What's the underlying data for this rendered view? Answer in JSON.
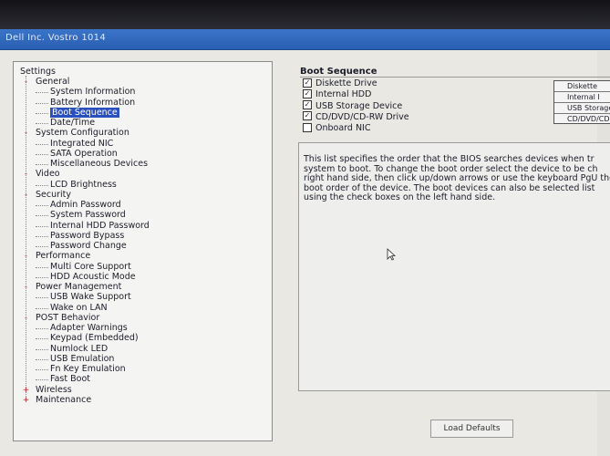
{
  "window": {
    "title": "Dell Inc. Vostro 1014"
  },
  "tree": {
    "root_label": "Settings",
    "items": [
      {
        "label": "General",
        "level": 1,
        "expander": "-"
      },
      {
        "label": "System Information",
        "level": 2
      },
      {
        "label": "Battery Information",
        "level": 2
      },
      {
        "label": "Boot Sequence",
        "level": 2,
        "selected": true
      },
      {
        "label": "Date/Time",
        "level": 2
      },
      {
        "label": "System Configuration",
        "level": 1,
        "expander": "-"
      },
      {
        "label": "Integrated NIC",
        "level": 2
      },
      {
        "label": "SATA Operation",
        "level": 2
      },
      {
        "label": "Miscellaneous Devices",
        "level": 2
      },
      {
        "label": "Video",
        "level": 1,
        "expander": "-"
      },
      {
        "label": "LCD Brightness",
        "level": 2
      },
      {
        "label": "Security",
        "level": 1,
        "expander": "-"
      },
      {
        "label": "Admin Password",
        "level": 2
      },
      {
        "label": "System Password",
        "level": 2
      },
      {
        "label": "Internal HDD Password",
        "level": 2
      },
      {
        "label": "Password Bypass",
        "level": 2
      },
      {
        "label": "Password Change",
        "level": 2
      },
      {
        "label": "Performance",
        "level": 1,
        "expander": "-"
      },
      {
        "label": "Multi Core Support",
        "level": 2
      },
      {
        "label": "HDD Acoustic Mode",
        "level": 2
      },
      {
        "label": "Power Management",
        "level": 1,
        "expander": "-"
      },
      {
        "label": "USB Wake Support",
        "level": 2
      },
      {
        "label": "Wake on LAN",
        "level": 2
      },
      {
        "label": "POST Behavior",
        "level": 1,
        "expander": "-"
      },
      {
        "label": "Adapter Warnings",
        "level": 2
      },
      {
        "label": "Keypad (Embedded)",
        "level": 2
      },
      {
        "label": "Numlock LED",
        "level": 2
      },
      {
        "label": "USB Emulation",
        "level": 2
      },
      {
        "label": "Fn Key Emulation",
        "level": 2
      },
      {
        "label": "Fast Boot",
        "level": 2
      },
      {
        "label": "Wireless",
        "level": 1,
        "expander": "+"
      },
      {
        "label": "Maintenance",
        "level": 1,
        "expander": "+"
      }
    ]
  },
  "boot_sequence": {
    "title": "Boot Sequence",
    "devices": [
      {
        "label": "Diskette Drive",
        "checked": true
      },
      {
        "label": "Internal HDD",
        "checked": true
      },
      {
        "label": "USB Storage Device",
        "checked": true
      },
      {
        "label": "CD/DVD/CD-RW Drive",
        "checked": true
      },
      {
        "label": "Onboard NIC",
        "checked": false
      }
    ],
    "order": [
      "Diskette",
      "Internal I",
      "USB Storage",
      "CD/DVD/CD-"
    ],
    "description": "This list specifies the order that the BIOS searches devices when tr system to boot. To change the boot order select the device to be ch right hand side, then click up/down arrows or use the keyboard PgU the boot order of the device. The boot devices can also be selected list using the check boxes on the left hand side."
  },
  "buttons": {
    "load_defaults": "Load Defaults"
  },
  "icons": {
    "checkmark": "check-icon",
    "cursor": "mouse-pointer-icon"
  },
  "colors": {
    "selection": "#2a4fbf",
    "titlebar": "#2a5fb3"
  }
}
